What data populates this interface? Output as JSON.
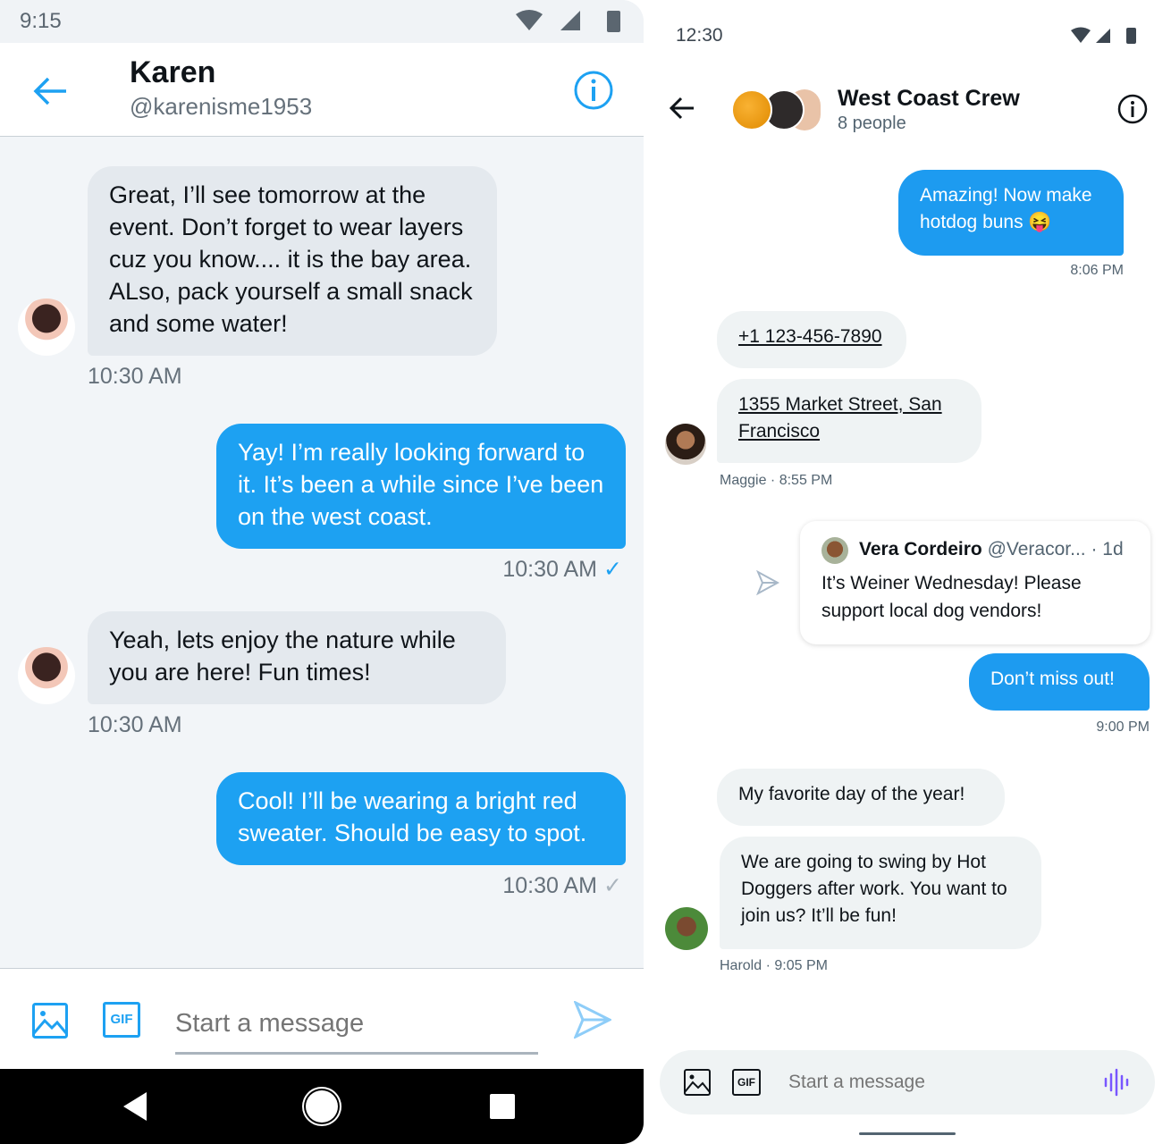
{
  "left": {
    "status": {
      "time": "9:15"
    },
    "header": {
      "name": "Karen",
      "handle": "@karenisme1953"
    },
    "messages": [
      {
        "dir": "in",
        "text": "Great, I’ll see tomorrow at the event. Don’t forget to wear layers cuz you know.... it is the bay area. ALso, pack yourself a small snack and some water!",
        "time": "10:30 AM"
      },
      {
        "dir": "out",
        "text": "Yay! I’m really looking forward to it. It’s been a while since I’ve been on the west coast.",
        "time": "10:30 AM",
        "status": "read"
      },
      {
        "dir": "in",
        "text": "Yeah, lets enjoy the nature while you are here! Fun times!",
        "time": "10:30 AM"
      },
      {
        "dir": "out",
        "text": "Cool! I’ll be wearing a bright red sweater. Should be easy to spot.",
        "time": "10:30 AM",
        "status": "sent"
      }
    ],
    "composer": {
      "placeholder": "Start a message",
      "gif": "GIF"
    }
  },
  "right": {
    "status": {
      "time": "12:30"
    },
    "header": {
      "title": "West Coast Crew",
      "subtitle": "8 people"
    },
    "messages": {
      "m1": {
        "text": "Amazing! Now make hotdog buns 😝",
        "time": "8:06 PM"
      },
      "m2": {
        "text": "+1 123-456-7890"
      },
      "m3": {
        "text": "1355 Market Street, San Francisco",
        "meta": "Maggie · 8:55 PM"
      },
      "tweet": {
        "name": "Vera Cordeiro",
        "handle": "@Veracor...",
        "age": "· 1d",
        "text": "It’s Weiner Wednesday! Please support local dog vendors!"
      },
      "m4": {
        "text": "Don’t miss out!",
        "time": "9:00 PM"
      },
      "m5": {
        "text": "My favorite day of the year!"
      },
      "m6": {
        "text": "We are going to swing by Hot Doggers after work. You want to join us? It’ll be fun!",
        "meta": "Harold · 9:05 PM"
      }
    },
    "composer": {
      "placeholder": "Start a message",
      "gif": "GIF"
    }
  },
  "colors": {
    "accent": "#1da1f2",
    "voice": "#7856ff"
  }
}
